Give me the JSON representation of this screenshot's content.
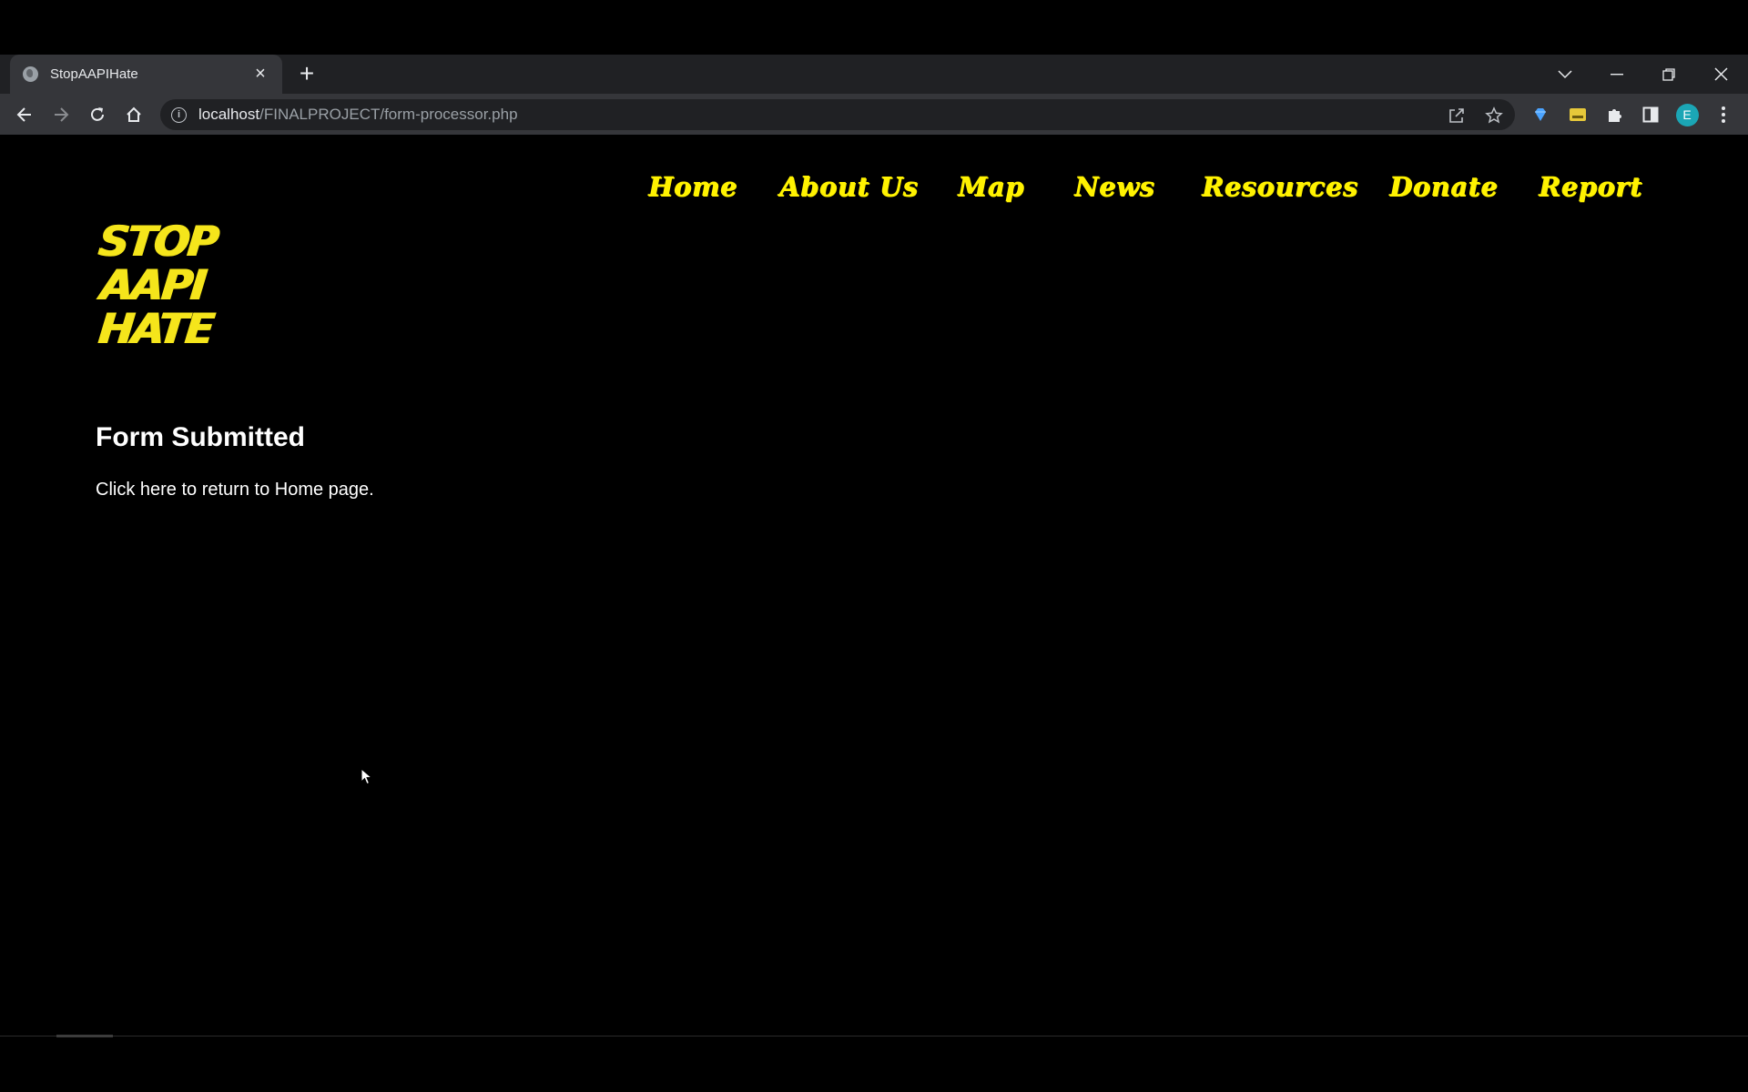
{
  "browser": {
    "tab_title": "StopAAPIHate",
    "new_tab_label": "+",
    "url_host": "localhost",
    "url_path": "/FINALPROJECT/form-processor.php",
    "profile_initial": "E"
  },
  "site": {
    "logo_lines": [
      "STOP",
      "AAPI",
      "HATE"
    ],
    "nav": [
      "Home",
      "About Us",
      "Map",
      "News",
      "Resources",
      "Donate",
      "Report"
    ],
    "accent_color": "#fff200"
  },
  "content": {
    "heading": "Form Submitted",
    "return_link": "Click here to return to Home page."
  }
}
